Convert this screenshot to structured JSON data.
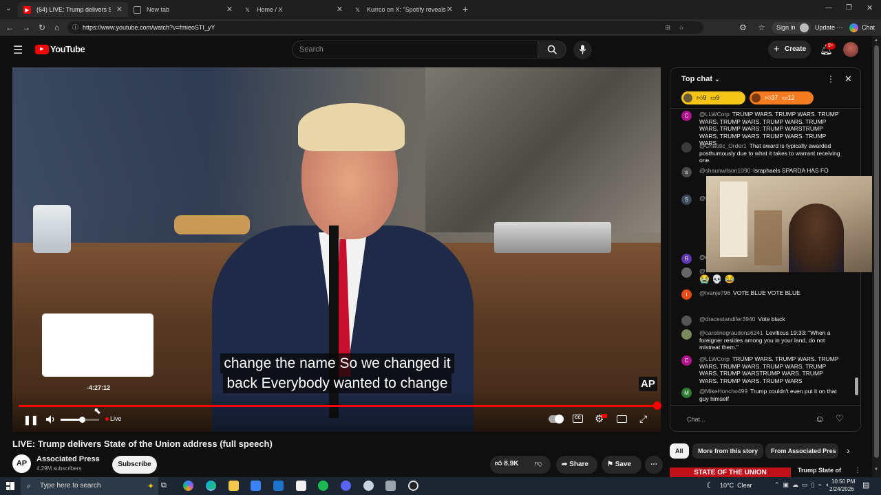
{
  "browser": {
    "tabs": [
      {
        "label": "(64) LIVE: Trump delivers State",
        "active": true,
        "icon": "youtube-icon"
      },
      {
        "label": "New tab",
        "active": false,
        "icon": "new-tab-icon"
      },
      {
        "label": "Home / X",
        "active": false,
        "icon": "x-icon"
      },
      {
        "label": "Kurrco on X: \"Spotify reveals its li",
        "active": false,
        "icon": "x-icon"
      }
    ],
    "url": "https://www.youtube.com/watch?v=fmieoSTI_yY",
    "sign_in_label": "Sign in",
    "update_label": "Update",
    "chat_label": "Chat"
  },
  "youtube": {
    "logo_text": "YouTube",
    "search_placeholder": "Search",
    "create_label": "Create",
    "notifications_badge": "9+"
  },
  "player": {
    "captions": [
      "change the name So we changed it",
      "back Everybody wanted to change"
    ],
    "hover_time": "-4:27:12",
    "live_label": "Live",
    "watermark": "AP",
    "progress_fraction": 1.0,
    "volume_fraction": 0.55
  },
  "video": {
    "title": "LIVE: Trump delivers State of the Union address (full speech)",
    "channel": "Associated Press",
    "subscribers": "4.29M subscribers",
    "subscribe_label": "Subscribe",
    "likes": "8.9K",
    "share_label": "Share",
    "save_label": "Save"
  },
  "chat": {
    "header": "Top chat",
    "pinned": [
      {
        "likes": "9",
        "comments": "9",
        "color": "#f5c518"
      },
      {
        "likes": "37",
        "comments": "12",
        "color": "#f47b20"
      }
    ],
    "messages": [
      {
        "author": "@LLWCorp",
        "text": "TRUMP WARS. TRUMP WARS. TRUMP WARS. TRUMP WARS. TRUMP WARS. TRUMP WARS. TRUMP WARS. TRUMP WARSTRUMP WARS. TRUMP WARS. TRUMP WARS. TRUMP WARS",
        "avatar": "C",
        "color": "#b0138d"
      },
      {
        "author": "@Chaotic_Order1",
        "text": "That award is typically awarded posthumously due to what it takes to warrant receiving one.",
        "avatar": "",
        "color": "#3a3a3a"
      },
      {
        "author": "@shaunwilson1090",
        "text": "Israphaels SPARDA HAS FO",
        "avatar": "s",
        "color": "#4a4a4a"
      },
      {
        "author": "@s",
        "text": "",
        "avatar": "S",
        "color": "#3b4a5c"
      },
      {
        "author": "@r",
        "text": "",
        "avatar": "R",
        "color": "#5e35b1"
      },
      {
        "author": "@",
        "text": "",
        "avatar": "",
        "color": "#666"
      },
      {
        "author": "@ivanje796",
        "text": "VOTE BLUE VOTE BLUE",
        "avatar": "i",
        "color": "#e64a19"
      },
      {
        "author": "@dracestandifer3940",
        "text": "Vote black",
        "avatar": "",
        "color": "#555"
      },
      {
        "author": "@carolinegraudons6241",
        "text": "Leviticus 19:33: \"When a foreigner resides among you in your land, do not mistreat them.\"",
        "avatar": "",
        "color": "#7a8a5a"
      },
      {
        "author": "@LLWCorp",
        "text": "TRUMP WARS. TRUMP WARS. TRUMP WARS. TRUMP WARS. TRUMP WARS. TRUMP WARS. TRUMP WARSTRUMP WARS. TRUMP WARS. TRUMP WARS. TRUMP WARS",
        "avatar": "C",
        "color": "#b0138d"
      },
      {
        "author": "@MikeHoncho499",
        "text": "Trump couldn't even put it on that guy himself",
        "avatar": "M",
        "color": "#2e7d32"
      }
    ],
    "input_placeholder": "Chat...",
    "emoji_row": "😭 💀 😂"
  },
  "chips": [
    "All",
    "More from this story",
    "From Associated Pres"
  ],
  "related": {
    "title": "Trump State of",
    "thumb_text": "STATE OF THE UNION"
  },
  "taskbar": {
    "search_placeholder": "Type here to search",
    "weather": "10°C  Clear",
    "time": "10:50 PM",
    "date": "2/24/2026"
  },
  "colors": {
    "accent": "#ff0000",
    "bg": "#0f0f0f",
    "brand": "#ff0000"
  }
}
